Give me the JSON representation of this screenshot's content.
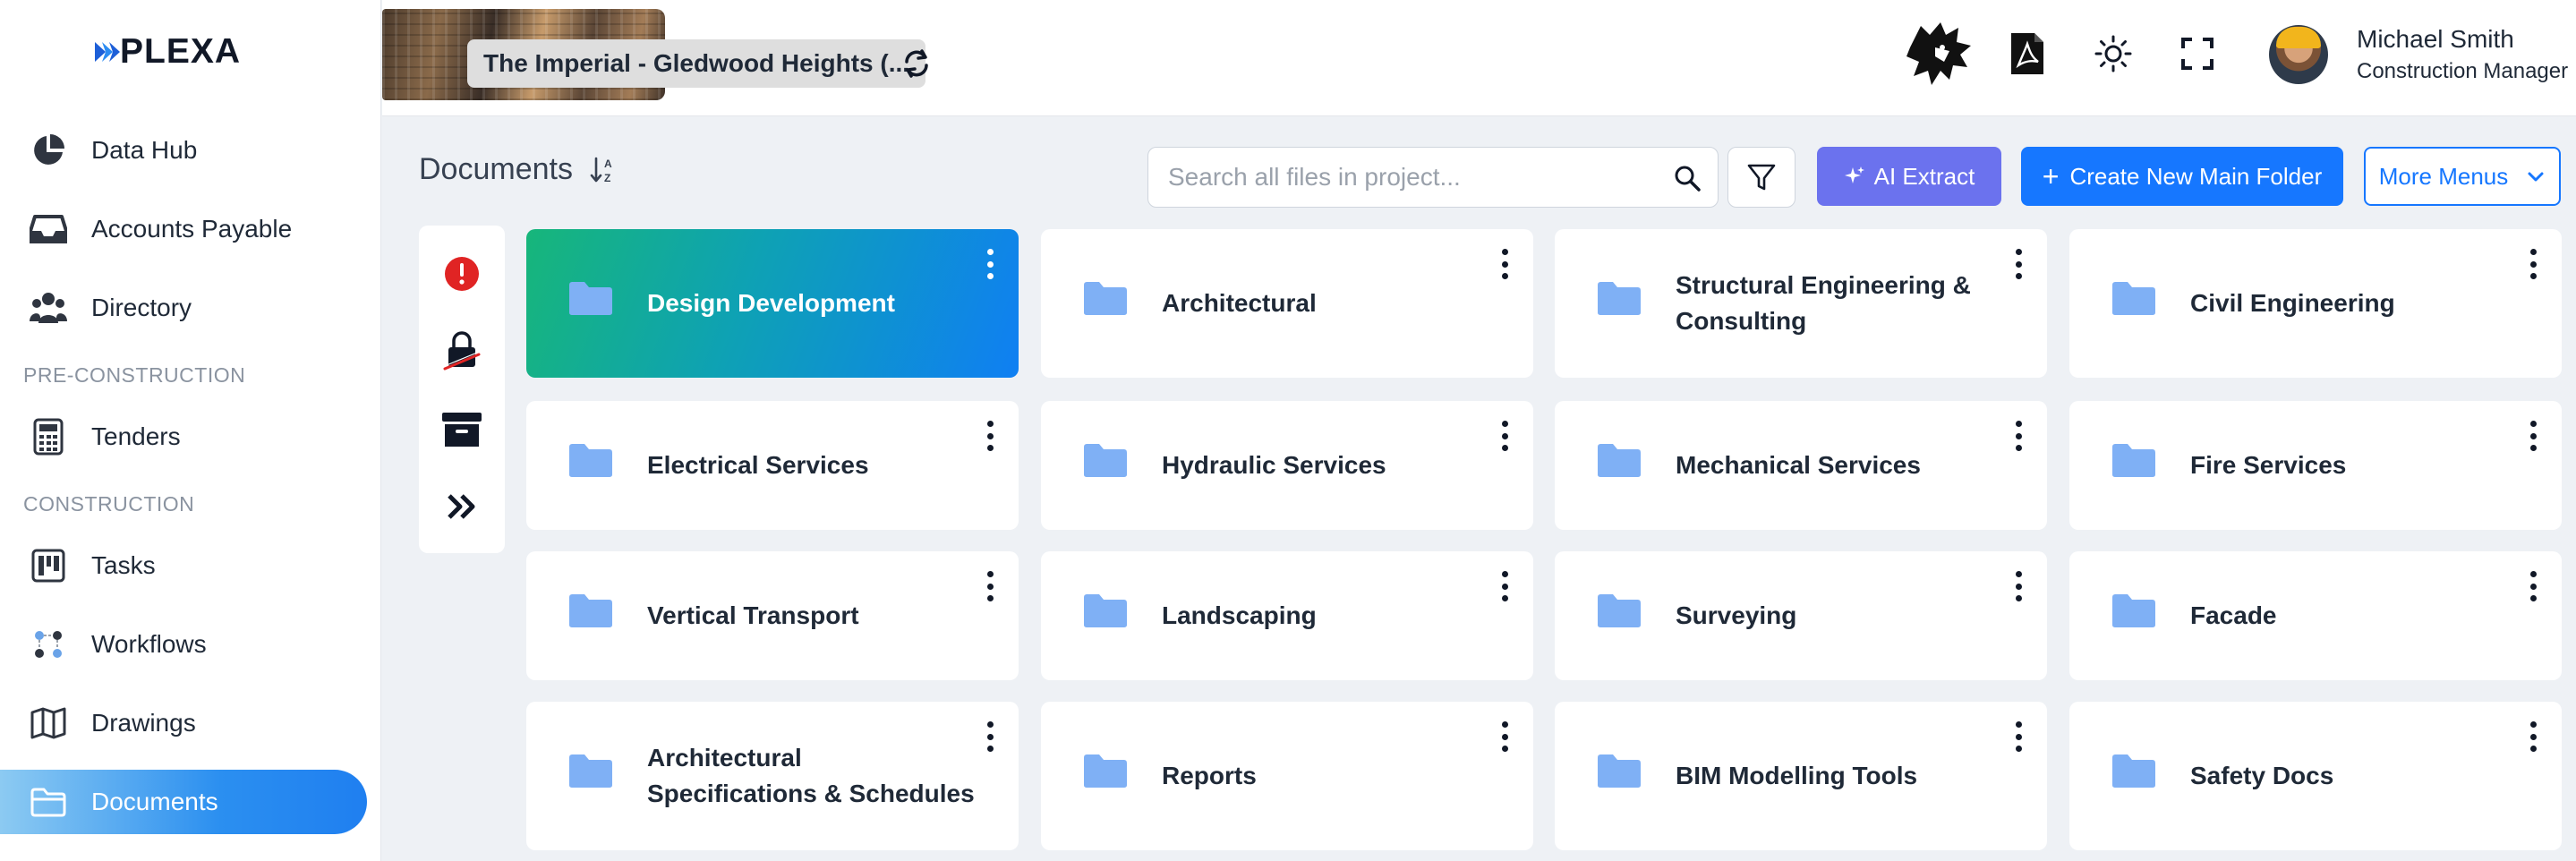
{
  "brand": {
    "name": "PLEXA"
  },
  "sidebar": {
    "items": [
      {
        "label": "Data Hub",
        "icon": "pie-chart-icon"
      },
      {
        "label": "Accounts Payable",
        "icon": "inbox-tray-icon"
      },
      {
        "label": "Directory",
        "icon": "people-icon"
      },
      {
        "label": "Tenders",
        "icon": "calculator-icon"
      },
      {
        "label": "Tasks",
        "icon": "kanban-icon"
      },
      {
        "label": "Workflows",
        "icon": "workflow-icon"
      },
      {
        "label": "Drawings",
        "icon": "map-icon"
      },
      {
        "label": "Documents",
        "icon": "folder-icon",
        "active": true
      }
    ],
    "sections": {
      "pre_construction": "PRE-CONSTRUCTION",
      "construction": "CONSTRUCTION"
    }
  },
  "header": {
    "project_name": "The Imperial - Gledwood Heights (...",
    "user_name": "Michael Smith",
    "user_role": "Construction Manager",
    "icons": [
      "lion-logo-icon",
      "pdf-icon",
      "sun-icon",
      "fullscreen-icon"
    ]
  },
  "toolbar": {
    "title": "Documents",
    "search_placeholder": "Search all files in project...",
    "ai_label": "AI Extract",
    "create_label": "Create New Main Folder",
    "more_label": "More Menus"
  },
  "colors": {
    "accent": "#1677ff",
    "ai": "#6b72ee",
    "folder": "#7fb0f5",
    "featured_from": "#17b67a",
    "featured_to": "#0f7ff3"
  },
  "folders": [
    {
      "label": "Design Development",
      "featured": true
    },
    {
      "label": "Architectural"
    },
    {
      "label": "Structural Engineering & Consulting"
    },
    {
      "label": "Civil Engineering"
    },
    {
      "label": "Electrical Services"
    },
    {
      "label": "Hydraulic Services"
    },
    {
      "label": "Mechanical Services"
    },
    {
      "label": "Fire Services"
    },
    {
      "label": "Vertical Transport"
    },
    {
      "label": "Landscaping"
    },
    {
      "label": "Surveying"
    },
    {
      "label": "Facade"
    },
    {
      "label": "Architectural Specifications & Schedules"
    },
    {
      "label": "Reports"
    },
    {
      "label": "BIM Modelling Tools"
    },
    {
      "label": "Safety Docs"
    }
  ]
}
